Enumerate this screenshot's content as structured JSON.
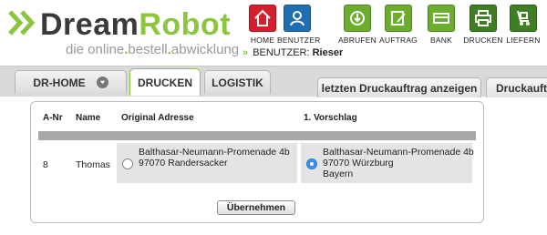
{
  "brand": {
    "name_part1": "Dream",
    "name_part2": "Robot",
    "tagline_part1": "die online",
    "tagline_dot1": ".",
    "tagline_part2": "bestell",
    "tagline_dot2": ".",
    "tagline_part3": "abwicklung",
    "accent_color": "#8cc63f"
  },
  "toolbar": [
    {
      "label": "HOME",
      "icon": "home-icon",
      "color": "#d4202c"
    },
    {
      "label": "BENUTZER",
      "icon": "user-icon",
      "color": "#1f6db3"
    },
    {
      "label": "ABRUFEN",
      "icon": "download-icon",
      "color": "#6cad2e"
    },
    {
      "label": "AUFTRAG",
      "icon": "order-edit-icon",
      "color": "#6cad2e"
    },
    {
      "label": "BANK",
      "icon": "bank-card-icon",
      "color": "#6cad2e"
    },
    {
      "label": "DRUCKEN",
      "icon": "printer-icon",
      "color": "#3f7f23"
    },
    {
      "label": "LIEFERN",
      "icon": "delivery-truck-icon",
      "color": "#3f7f23"
    }
  ],
  "user_line": {
    "label": "BENUTZER:",
    "name": "Rieser"
  },
  "tabs": {
    "main": [
      {
        "label": "DR-HOME",
        "has_dropdown": true,
        "active": false
      },
      {
        "label": "DRUCKEN",
        "active": true
      },
      {
        "label": "LOGISTIK",
        "active": false
      }
    ],
    "sub": [
      {
        "label": "letzten Druckauftrag anzeigen"
      },
      {
        "label": "Druckauftr"
      }
    ]
  },
  "table": {
    "headers": {
      "anr": "A-Nr",
      "name": "Name",
      "original": "Original Adresse",
      "suggestion": "1. Vorschlag"
    },
    "row": {
      "anr": "8",
      "name": "Thomas",
      "original": {
        "line1": "Balthasar-Neumann-Promenade 4b",
        "line2": "97070 Randersacker",
        "selected": false
      },
      "suggestion": {
        "line1": "Balthasar-Neumann-Promenade 4b",
        "line2": "97070 Würzburg",
        "line3": "Bayern",
        "selected": true
      }
    }
  },
  "submit_label": "Übernehmen"
}
